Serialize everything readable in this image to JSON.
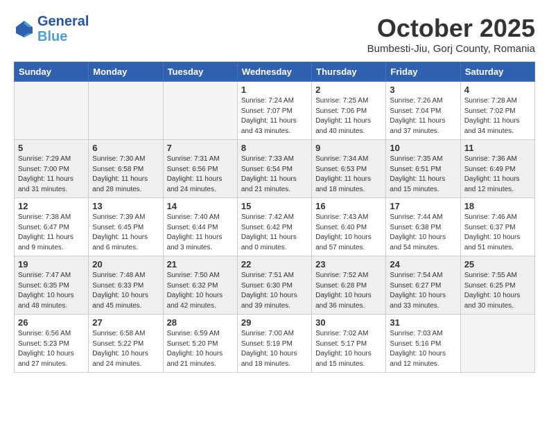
{
  "header": {
    "logo_line1": "General",
    "logo_line2": "Blue",
    "month": "October 2025",
    "location": "Bumbesti-Jiu, Gorj County, Romania"
  },
  "weekdays": [
    "Sunday",
    "Monday",
    "Tuesday",
    "Wednesday",
    "Thursday",
    "Friday",
    "Saturday"
  ],
  "weeks": [
    [
      {
        "day": "",
        "info": ""
      },
      {
        "day": "",
        "info": ""
      },
      {
        "day": "",
        "info": ""
      },
      {
        "day": "1",
        "info": "Sunrise: 7:24 AM\nSunset: 7:07 PM\nDaylight: 11 hours\nand 43 minutes."
      },
      {
        "day": "2",
        "info": "Sunrise: 7:25 AM\nSunset: 7:06 PM\nDaylight: 11 hours\nand 40 minutes."
      },
      {
        "day": "3",
        "info": "Sunrise: 7:26 AM\nSunset: 7:04 PM\nDaylight: 11 hours\nand 37 minutes."
      },
      {
        "day": "4",
        "info": "Sunrise: 7:28 AM\nSunset: 7:02 PM\nDaylight: 11 hours\nand 34 minutes."
      }
    ],
    [
      {
        "day": "5",
        "info": "Sunrise: 7:29 AM\nSunset: 7:00 PM\nDaylight: 11 hours\nand 31 minutes."
      },
      {
        "day": "6",
        "info": "Sunrise: 7:30 AM\nSunset: 6:58 PM\nDaylight: 11 hours\nand 28 minutes."
      },
      {
        "day": "7",
        "info": "Sunrise: 7:31 AM\nSunset: 6:56 PM\nDaylight: 11 hours\nand 24 minutes."
      },
      {
        "day": "8",
        "info": "Sunrise: 7:33 AM\nSunset: 6:54 PM\nDaylight: 11 hours\nand 21 minutes."
      },
      {
        "day": "9",
        "info": "Sunrise: 7:34 AM\nSunset: 6:53 PM\nDaylight: 11 hours\nand 18 minutes."
      },
      {
        "day": "10",
        "info": "Sunrise: 7:35 AM\nSunset: 6:51 PM\nDaylight: 11 hours\nand 15 minutes."
      },
      {
        "day": "11",
        "info": "Sunrise: 7:36 AM\nSunset: 6:49 PM\nDaylight: 11 hours\nand 12 minutes."
      }
    ],
    [
      {
        "day": "12",
        "info": "Sunrise: 7:38 AM\nSunset: 6:47 PM\nDaylight: 11 hours\nand 9 minutes."
      },
      {
        "day": "13",
        "info": "Sunrise: 7:39 AM\nSunset: 6:45 PM\nDaylight: 11 hours\nand 6 minutes."
      },
      {
        "day": "14",
        "info": "Sunrise: 7:40 AM\nSunset: 6:44 PM\nDaylight: 11 hours\nand 3 minutes."
      },
      {
        "day": "15",
        "info": "Sunrise: 7:42 AM\nSunset: 6:42 PM\nDaylight: 11 hours\nand 0 minutes."
      },
      {
        "day": "16",
        "info": "Sunrise: 7:43 AM\nSunset: 6:40 PM\nDaylight: 10 hours\nand 57 minutes."
      },
      {
        "day": "17",
        "info": "Sunrise: 7:44 AM\nSunset: 6:38 PM\nDaylight: 10 hours\nand 54 minutes."
      },
      {
        "day": "18",
        "info": "Sunrise: 7:46 AM\nSunset: 6:37 PM\nDaylight: 10 hours\nand 51 minutes."
      }
    ],
    [
      {
        "day": "19",
        "info": "Sunrise: 7:47 AM\nSunset: 6:35 PM\nDaylight: 10 hours\nand 48 minutes."
      },
      {
        "day": "20",
        "info": "Sunrise: 7:48 AM\nSunset: 6:33 PM\nDaylight: 10 hours\nand 45 minutes."
      },
      {
        "day": "21",
        "info": "Sunrise: 7:50 AM\nSunset: 6:32 PM\nDaylight: 10 hours\nand 42 minutes."
      },
      {
        "day": "22",
        "info": "Sunrise: 7:51 AM\nSunset: 6:30 PM\nDaylight: 10 hours\nand 39 minutes."
      },
      {
        "day": "23",
        "info": "Sunrise: 7:52 AM\nSunset: 6:28 PM\nDaylight: 10 hours\nand 36 minutes."
      },
      {
        "day": "24",
        "info": "Sunrise: 7:54 AM\nSunset: 6:27 PM\nDaylight: 10 hours\nand 33 minutes."
      },
      {
        "day": "25",
        "info": "Sunrise: 7:55 AM\nSunset: 6:25 PM\nDaylight: 10 hours\nand 30 minutes."
      }
    ],
    [
      {
        "day": "26",
        "info": "Sunrise: 6:56 AM\nSunset: 5:23 PM\nDaylight: 10 hours\nand 27 minutes."
      },
      {
        "day": "27",
        "info": "Sunrise: 6:58 AM\nSunset: 5:22 PM\nDaylight: 10 hours\nand 24 minutes."
      },
      {
        "day": "28",
        "info": "Sunrise: 6:59 AM\nSunset: 5:20 PM\nDaylight: 10 hours\nand 21 minutes."
      },
      {
        "day": "29",
        "info": "Sunrise: 7:00 AM\nSunset: 5:19 PM\nDaylight: 10 hours\nand 18 minutes."
      },
      {
        "day": "30",
        "info": "Sunrise: 7:02 AM\nSunset: 5:17 PM\nDaylight: 10 hours\nand 15 minutes."
      },
      {
        "day": "31",
        "info": "Sunrise: 7:03 AM\nSunset: 5:16 PM\nDaylight: 10 hours\nand 12 minutes."
      },
      {
        "day": "",
        "info": ""
      }
    ]
  ]
}
